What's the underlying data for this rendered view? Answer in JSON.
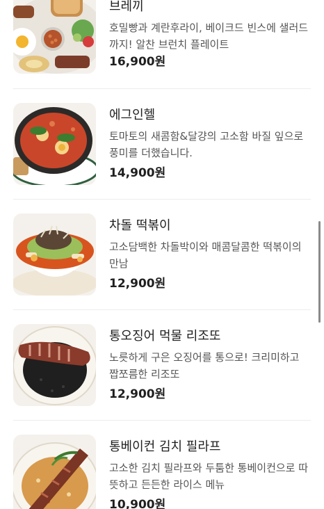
{
  "menu": {
    "items": [
      {
        "name": "브레끼",
        "description": "호밀빵과 계란후라이, 베이크드 빈스에 샐러드까지! 알찬 브런치 플레이트",
        "price": "16,900원",
        "image_icon": "brunch-plate-photo"
      },
      {
        "name": "에그인헬",
        "description": "토마토의 새콤함&달걍의 고소함 바질 잎으로 풍미를 더했습니다.",
        "price": "14,900원",
        "image_icon": "shakshuka-skillet-photo"
      },
      {
        "name": "차돌 떡볶이",
        "description": "고소담백한 차돌박이와 매콤달콤한 떡볶이의 만남",
        "price": "12,900원",
        "image_icon": "tteokbokki-bowl-photo"
      },
      {
        "name": "통오징어 먹물 리조또",
        "description": "노릇하게 구은 오징어를 통으로! 크리미하고 짭쪼름한 리조또",
        "price": "12,900원",
        "image_icon": "squid-ink-risotto-photo"
      },
      {
        "name": "통베이컨 김치 필라프",
        "description": "고소한 김치 필라프와 두툼한 통베이컨으로 따뜻하고 든든한 라이스 메뉴",
        "price": "10,900원",
        "image_icon": "kimchi-pilaf-bacon-photo"
      }
    ]
  }
}
